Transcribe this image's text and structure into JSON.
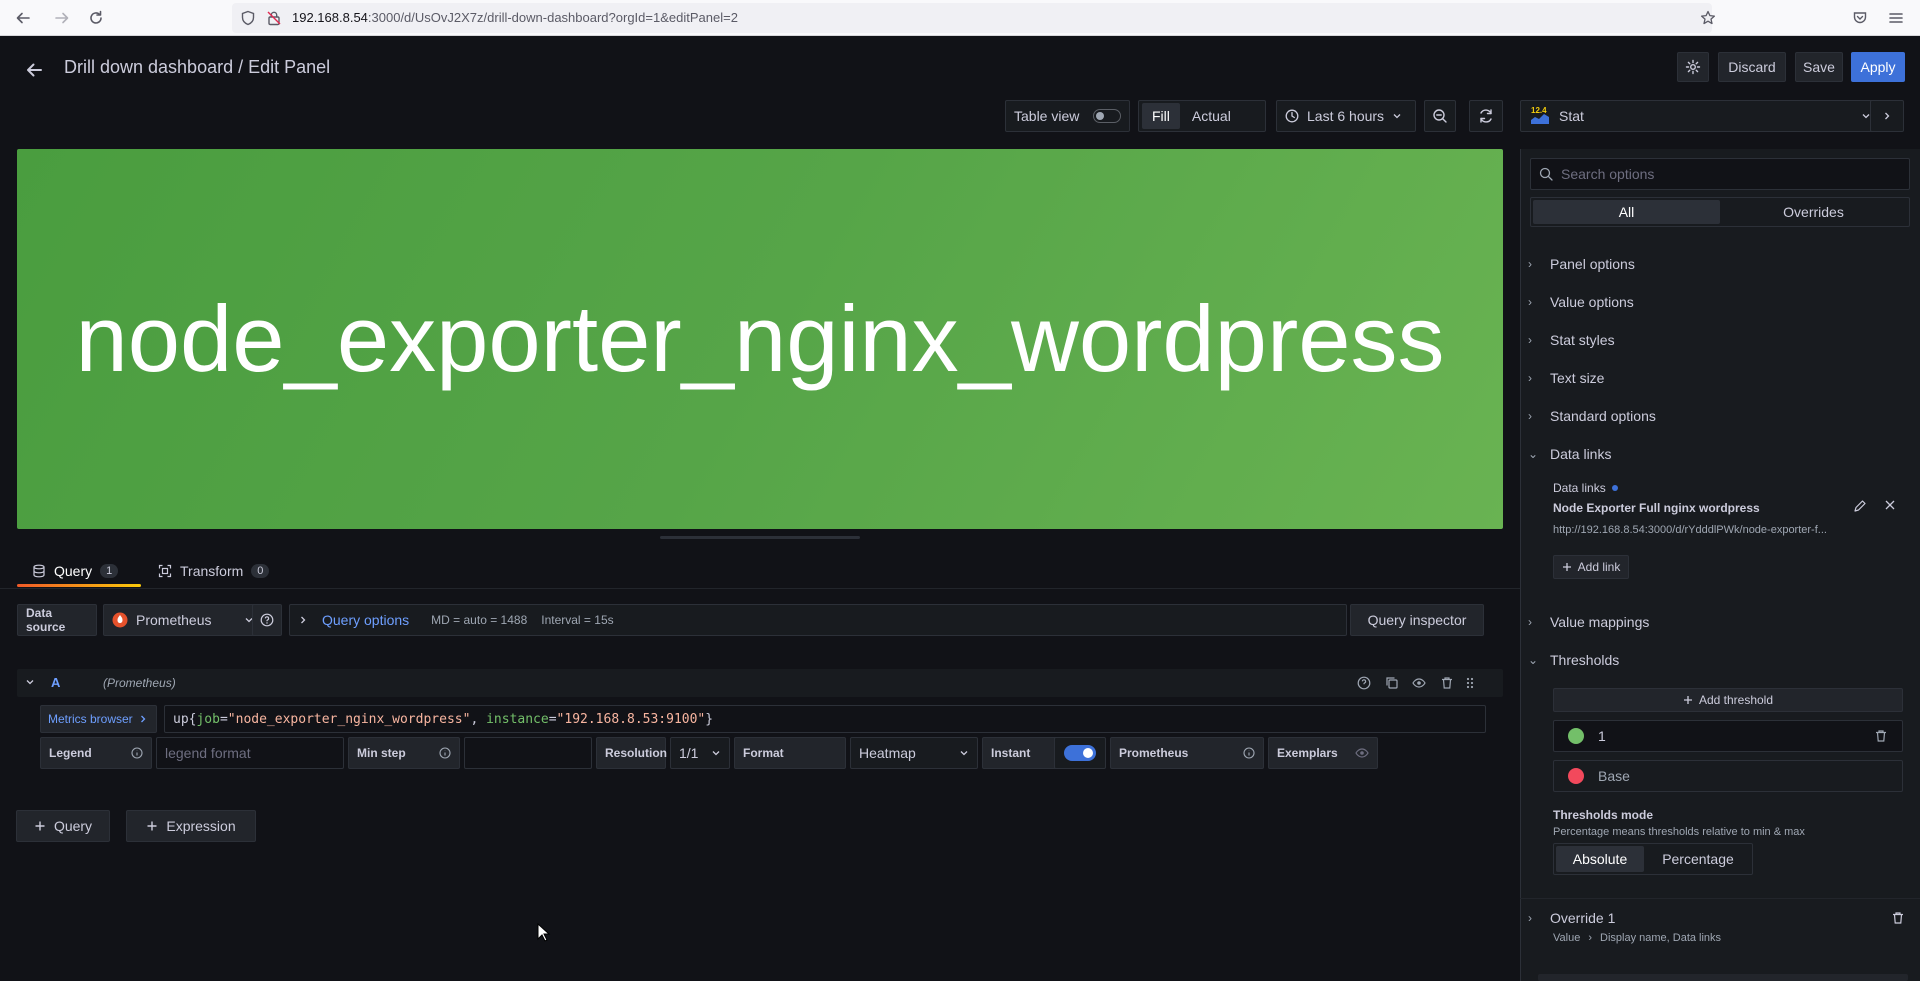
{
  "browser": {
    "url_host": "192.168.8.54",
    "url_rest": ":3000/d/UsOvJ2X7z/drill-down-dashboard?orgId=1&editPanel=2"
  },
  "header": {
    "title": "Drill down dashboard / Edit Panel",
    "discard_label": "Discard",
    "save_label": "Save",
    "apply_label": "Apply"
  },
  "toolbar": {
    "table_view_label": "Table view",
    "fill_label": "Fill",
    "actual_label": "Actual",
    "time_range": "Last 6 hours",
    "viz_type": "Stat",
    "viz_badge": "12.4"
  },
  "preview": {
    "stat_value": "node_exporter_nginx_wordpress",
    "background_color": "#56a548"
  },
  "tabs": [
    {
      "label": "Query",
      "count": "1"
    },
    {
      "label": "Transform",
      "count": "0"
    }
  ],
  "query_bar": {
    "data_source_label": "Data source",
    "data_source": "Prometheus",
    "query_options_label": "Query options",
    "md": "MD = auto = 1488",
    "interval": "Interval = 15s",
    "inspector_label": "Query inspector"
  },
  "query_a": {
    "ref_id": "A",
    "source_hint": "(Prometheus)",
    "metrics_browser_label": "Metrics browser",
    "expr": {
      "fn": "up",
      "open": "{",
      "l1": "job",
      "eq": "=",
      "v1": "\"node_exporter_nginx_wordpress\"",
      "sep": ", ",
      "l2": "instance",
      "v2": "\"192.168.8.53:9100\"",
      "close": "}"
    },
    "legend_label": "Legend",
    "legend_placeholder": "legend format",
    "min_step_label": "Min step",
    "resolution_label": "Resolution",
    "resolution_value": "1/1",
    "format_label": "Format",
    "format_value": "Heatmap",
    "instant_label": "Instant",
    "instant_on": true,
    "prometheus_label": "Prometheus",
    "exemplars_label": "Exemplars"
  },
  "add_buttons": {
    "query": "Query",
    "expression": "Expression"
  },
  "options": {
    "search_placeholder": "Search options",
    "tab_all": "All",
    "tab_overrides": "Overrides",
    "categories": {
      "panel": "Panel options",
      "value": "Value options",
      "stat_styles": "Stat styles",
      "text_size": "Text size",
      "standard": "Standard options",
      "data_links": "Data links",
      "value_mappings": "Value mappings",
      "thresholds": "Thresholds"
    },
    "data_links": {
      "heading": "Data links",
      "link_title": "Node Exporter Full nginx wordpress",
      "link_url": "http://192.168.8.54:3000/d/rYdddlPWk/node-exporter-f...",
      "add_link": "Add link"
    },
    "thresholds": {
      "add_threshold": "Add threshold",
      "step1_value": "1",
      "step1_color": "#73bf69",
      "base_label": "Base",
      "base_color": "#f2495c",
      "mode_label": "Thresholds mode",
      "mode_desc": "Percentage means thresholds relative to min & max",
      "mode_absolute": "Absolute",
      "mode_percentage": "Percentage"
    },
    "override": {
      "title": "Override 1",
      "path_a": "Value",
      "path_b": "Display name, Data links"
    }
  }
}
